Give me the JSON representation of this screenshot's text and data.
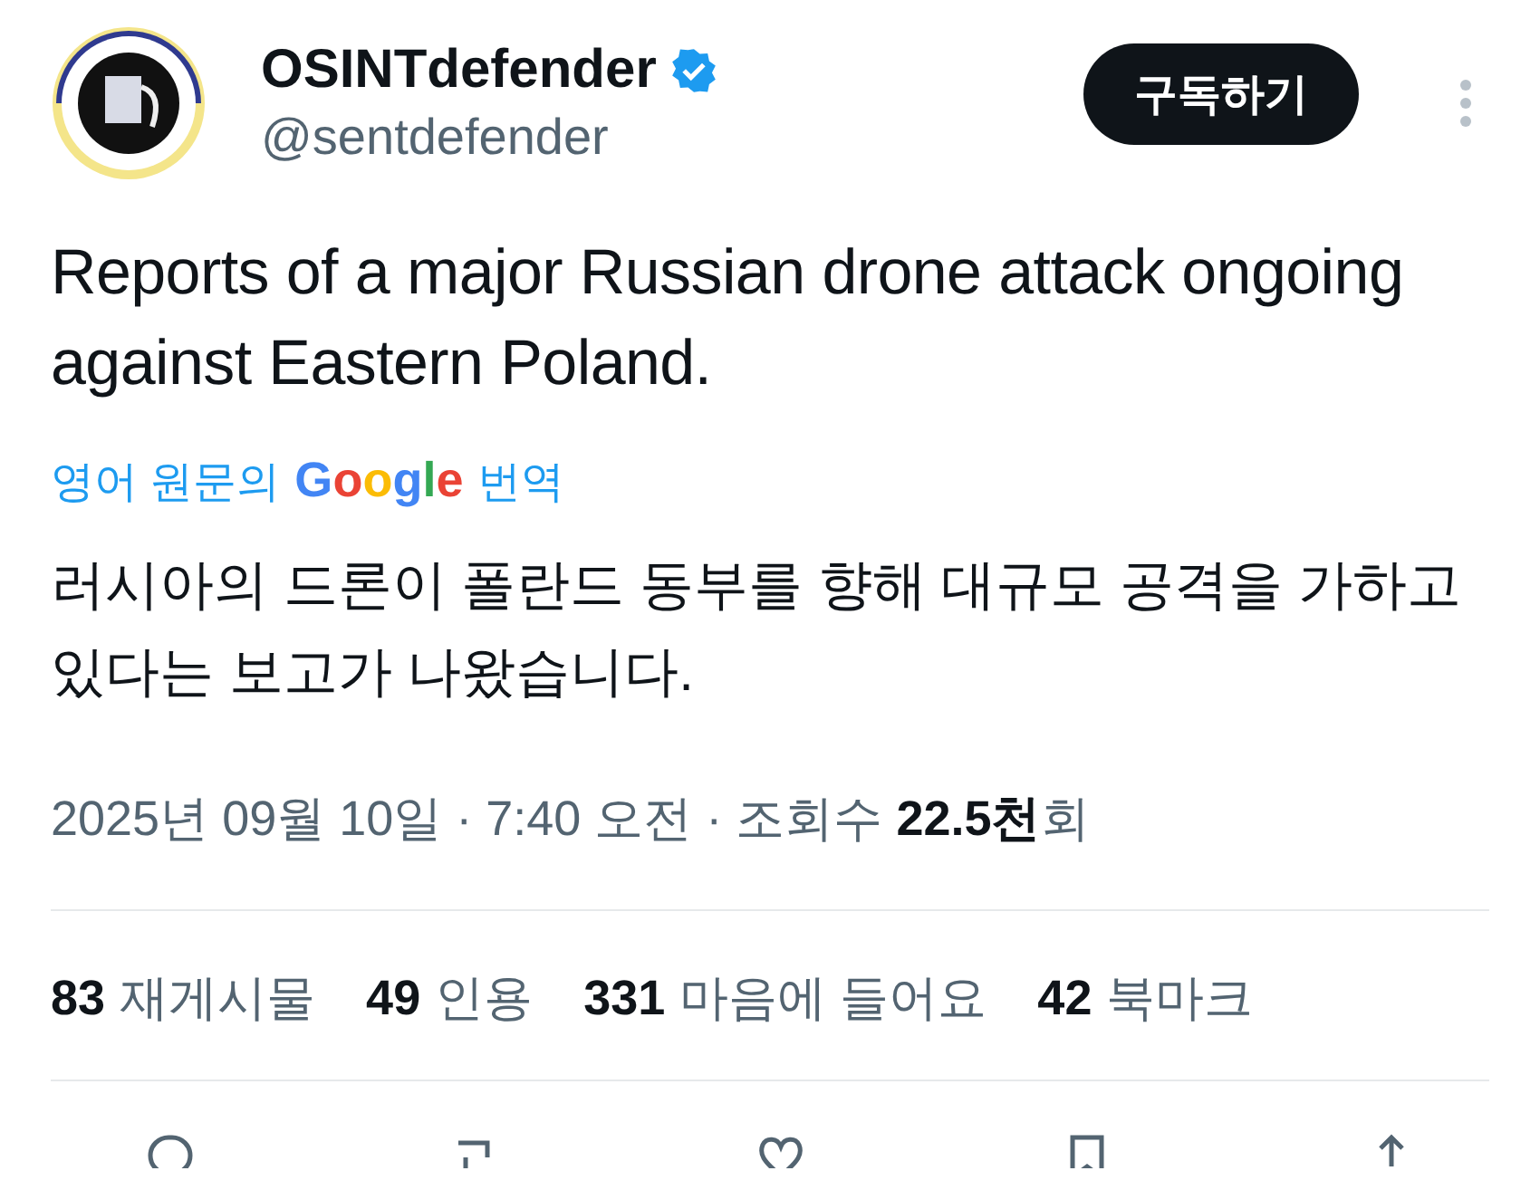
{
  "author": {
    "name": "OSINTdefender",
    "verified": true,
    "handle": "@sentdefender"
  },
  "follow_button": "구독하기",
  "post_text": "Reports of a major Russian drone attack ongoing against Eastern Poland.",
  "translation_label": {
    "before": "영어 원문의",
    "brand": "Google",
    "after": "번역"
  },
  "translated_text": "러시아의 드론이 폴란드 동부를 향해 대규모 공격을 가하고 있다는 보고가 나왔습니다.",
  "meta": "2025년 09월 10일 · 7:40 오전 · 조회수 **22.5천**회",
  "stats": [
    {
      "count": "83",
      "label": "재게시물"
    },
    {
      "count": "49",
      "label": "인용"
    },
    {
      "count": "331",
      "label": "마음에 들어요"
    },
    {
      "count": "42",
      "label": "북마크"
    }
  ]
}
